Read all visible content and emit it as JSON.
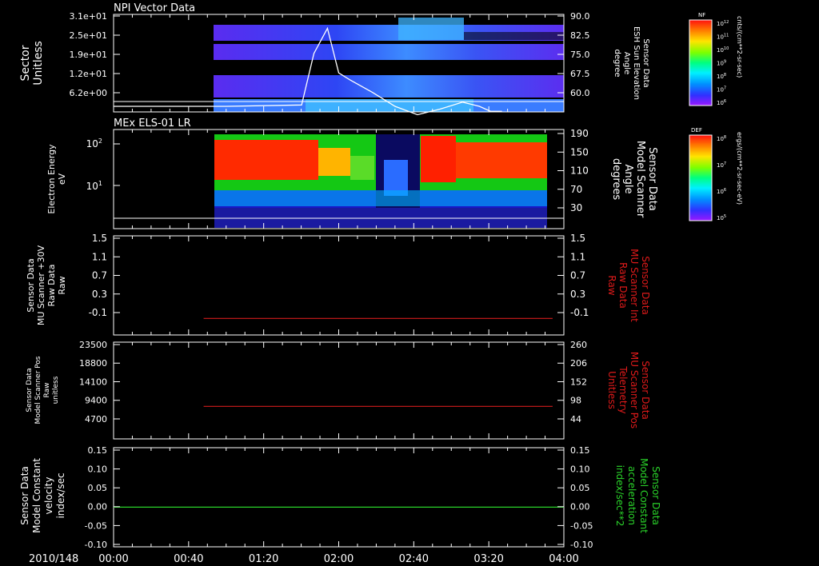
{
  "chart_data": [
    {
      "type": "heatmap",
      "title": "NPI Vector Data",
      "ylabel": "Sector\nUnitless",
      "yticks": [
        "3.1e+01",
        "2.5e+01",
        "1.9e+01",
        "1.2e+01",
        "6.2e+00"
      ],
      "y2label": "Sensor Data\nESH Sun Elevation\nAngle\ndegree",
      "y2ticks": [
        "90.0",
        "82.5",
        "75.0",
        "67.5",
        "60.0"
      ],
      "ylim2": [
        55,
        90
      ],
      "data_start_time": "00:48",
      "colorbar": {
        "label": "NF",
        "unit": "cnts/(cm**2-sr-sec)",
        "ticks": [
          "10^12",
          "10^11",
          "10^10",
          "10^9",
          "10^8",
          "10^7",
          "10^6"
        ]
      },
      "overlay_line": {
        "color": "#ffffff",
        "x_hours": [
          0.0,
          1.0,
          1.67,
          1.78,
          1.9,
          2.0,
          2.1,
          2.3,
          2.5,
          2.7,
          2.9,
          3.1,
          3.25,
          3.35,
          3.45
        ],
        "y_deg": [
          57,
          57,
          57.5,
          76,
          85,
          69,
          66.5,
          62,
          57,
          54,
          56,
          58.5,
          57,
          55.2,
          55.2
        ]
      }
    },
    {
      "type": "heatmap",
      "title": "MEx ELS-01 LR",
      "ylabel": "Electron Energy\neV",
      "yticks": [
        "10^2",
        "10^1"
      ],
      "y2label": "Sensor Data\nModel Scanner\nAngle\ndegrees",
      "y2ticks": [
        "190",
        "150",
        "110",
        "70",
        "30"
      ],
      "colorbar": {
        "label": "DEF",
        "unit": "ergs/(cm**2-sr-sec-eV)",
        "ticks": [
          "10^8",
          "10^7",
          "10^6",
          "10^5"
        ]
      },
      "overlay_line": {
        "color": "#ffffff",
        "y_deg": 10
      }
    },
    {
      "type": "line",
      "ylabel": "Sensor Data\nMU Scanner +30V\nRaw Data\nRaw",
      "yticks": [
        "1.5",
        "1.1",
        "0.7",
        "0.3",
        "-0.1"
      ],
      "ylim": [
        -0.3,
        1.5
      ],
      "y2label": "Sensor Data\nMU Scanner Int\nRaw Data\nRaw",
      "y2ticks": [
        "1.5",
        "1.1",
        "0.7",
        "0.3",
        "-0.1"
      ],
      "series": [
        {
          "color": "#d01c1c",
          "x_hours": [
            0.8,
            3.9
          ],
          "values": [
            0,
            0
          ]
        }
      ]
    },
    {
      "type": "line",
      "ylabel": "Sensor Data\nModel Scanner Pos\nRaw\nunitless",
      "yticks": [
        "23500",
        "18800",
        "14100",
        "9400",
        "4700"
      ],
      "ylim": [
        0,
        23500
      ],
      "y2label": "Sensor Data\nMU Scanner Pos\nTelemetry\nUnitless",
      "y2ticks": [
        "260",
        "206",
        "152",
        "98",
        "44"
      ],
      "series": [
        {
          "color": "#d01c1c",
          "x_hours": [
            0.8,
            3.9
          ],
          "values": [
            7900,
            7900
          ]
        }
      ]
    },
    {
      "type": "line",
      "ylabel": "Sensor Data\nModel Constant\nvelocity\nindex/sec",
      "yticks": [
        "0.15",
        "0.10",
        "0.05",
        "0.00",
        "-0.05",
        "-0.10"
      ],
      "ylim": [
        -0.1,
        0.15
      ],
      "y2label": "Sensor Data\nModel Constant\nacceleration\nindex/sec**2",
      "y2ticks": [
        "0.15",
        "0.10",
        "0.05",
        "0.00",
        "-0.05",
        "-0.10"
      ],
      "series": [
        {
          "color": "#2ad42a",
          "x_hours": [
            0.0,
            4.0
          ],
          "values": [
            0.0,
            0.0
          ]
        }
      ]
    }
  ],
  "time_axis": {
    "date": "2010/148",
    "ticks": [
      "00:00",
      "00:40",
      "01:20",
      "02:00",
      "02:40",
      "03:20",
      "04:00"
    ]
  },
  "colors": {
    "right_label_panel3": "#e01a1a",
    "right_label_panel4": "#e01a1a",
    "right_label_panel5": "#2ad42a"
  }
}
